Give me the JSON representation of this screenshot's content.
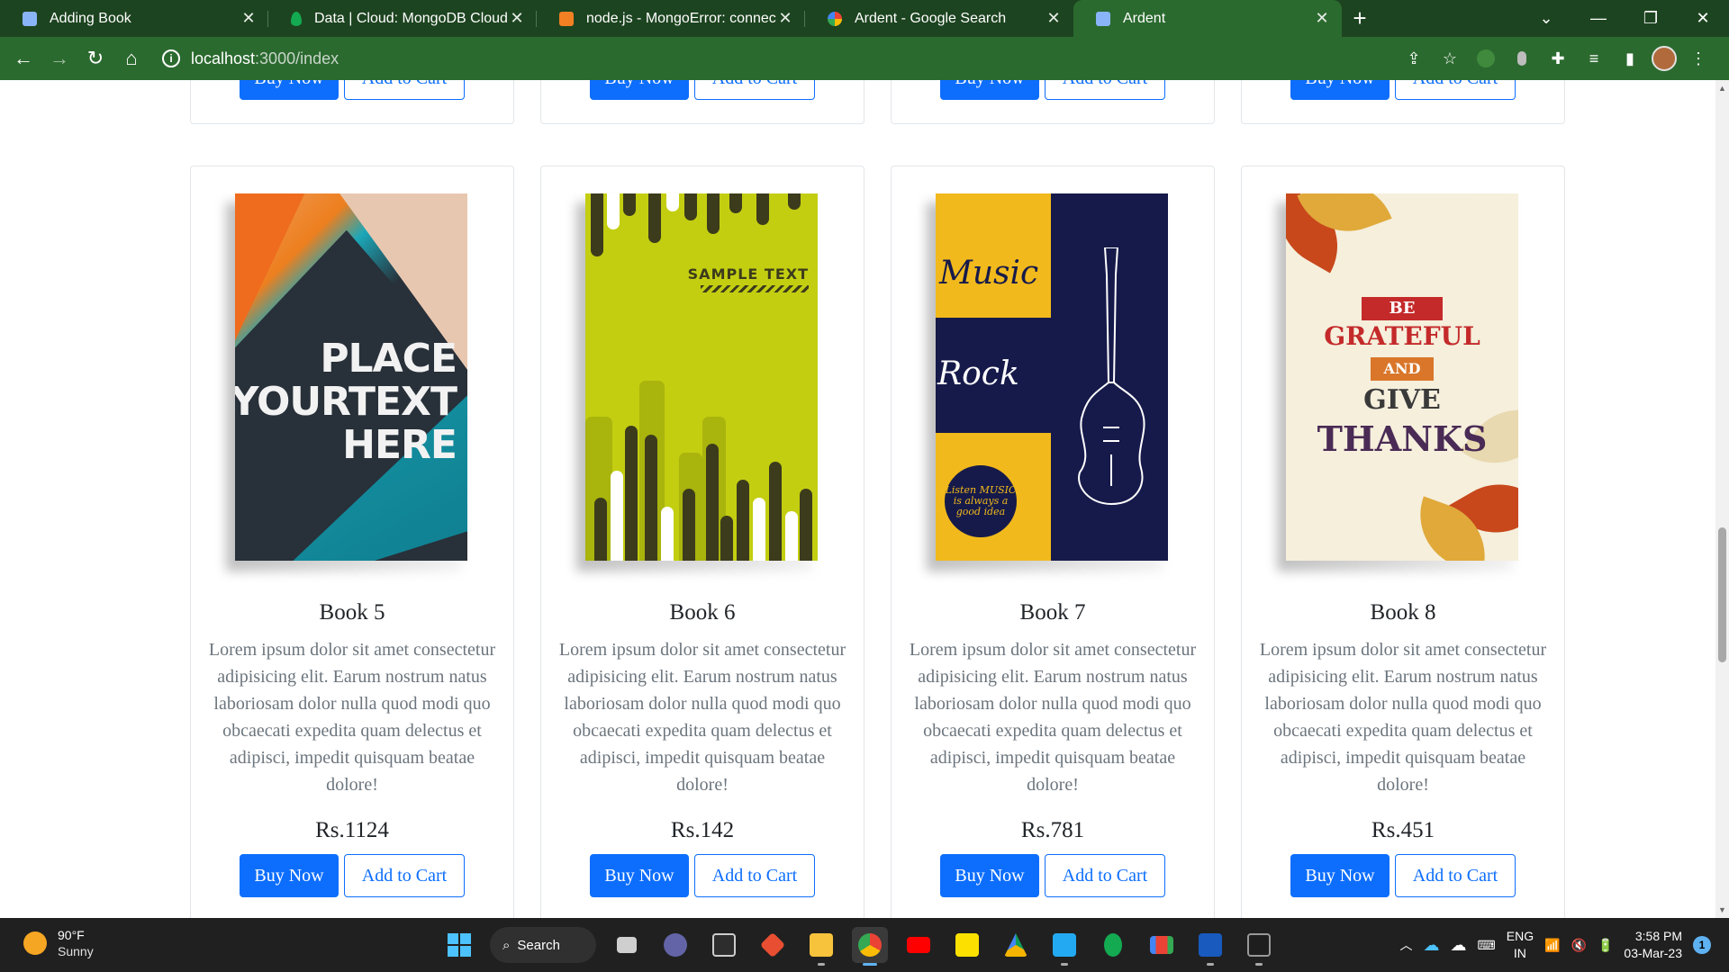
{
  "browser": {
    "tabs": [
      {
        "title": "Adding Book",
        "active": false
      },
      {
        "title": "Data | Cloud: MongoDB Cloud",
        "active": false
      },
      {
        "title": "node.js - MongoError: connect EC",
        "active": false
      },
      {
        "title": "Ardent - Google Search",
        "active": false
      },
      {
        "title": "Ardent",
        "active": true
      }
    ],
    "url_host": "localhost",
    "url_path": ":3000/index"
  },
  "top_row": [
    {
      "buy_label": "Buy Now",
      "cart_label": "Add to Cart"
    },
    {
      "buy_label": "Buy Now",
      "cart_label": "Add to Cart"
    },
    {
      "buy_label": "Buy Now",
      "cart_label": "Add to Cart"
    },
    {
      "buy_label": "Buy Now",
      "cart_label": "Add to Cart"
    }
  ],
  "books": [
    {
      "title": "Book 5",
      "description": "Lorem ipsum dolor sit amet consectetur adipisicing elit. Earum nostrum natus laboriosam dolor nulla quod modi quo obcaecati expedita quam delectus et adipisci, impedit quisquam beatae dolore!",
      "price": "Rs.1124",
      "buy_label": "Buy Now",
      "cart_label": "Add to Cart",
      "cover_text": [
        "PLACE",
        "YOURTEXT",
        "HERE"
      ]
    },
    {
      "title": "Book 6",
      "description": "Lorem ipsum dolor sit amet consectetur adipisicing elit. Earum nostrum natus laboriosam dolor nulla quod modi quo obcaecati expedita quam delectus et adipisci, impedit quisquam beatae dolore!",
      "price": "Rs.142",
      "buy_label": "Buy Now",
      "cart_label": "Add to Cart",
      "cover_text": [
        "SAMPLE TEXT"
      ]
    },
    {
      "title": "Book 7",
      "description": "Lorem ipsum dolor sit amet consectetur adipisicing elit. Earum nostrum natus laboriosam dolor nulla quod modi quo obcaecati expedita quam delectus et adipisci, impedit quisquam beatae dolore!",
      "price": "Rs.781",
      "buy_label": "Buy Now",
      "cart_label": "Add to Cart",
      "cover_text": [
        "Music",
        "Rock",
        "Listen MUSIC is always a good idea"
      ]
    },
    {
      "title": "Book 8",
      "description": "Lorem ipsum dolor sit amet consectetur adipisicing elit. Earum nostrum natus laboriosam dolor nulla quod modi quo obcaecati expedita quam delectus et adipisci, impedit quisquam beatae dolore!",
      "price": "Rs.451",
      "buy_label": "Buy Now",
      "cart_label": "Add to Cart",
      "cover_text": [
        "BE",
        "GRATEFUL",
        "AND",
        "GIVE",
        "THANKS"
      ]
    }
  ],
  "taskbar": {
    "temp": "90°F",
    "condition": "Sunny",
    "search_label": "Search",
    "lang_line1": "ENG",
    "lang_line2": "IN",
    "time": "3:58 PM",
    "date": "03-Mar-23",
    "notification_count": "1"
  },
  "colors": {
    "chrome_dark": "#1d4420",
    "chrome_light": "#2b6a2f",
    "primary": "#0d6efd"
  }
}
